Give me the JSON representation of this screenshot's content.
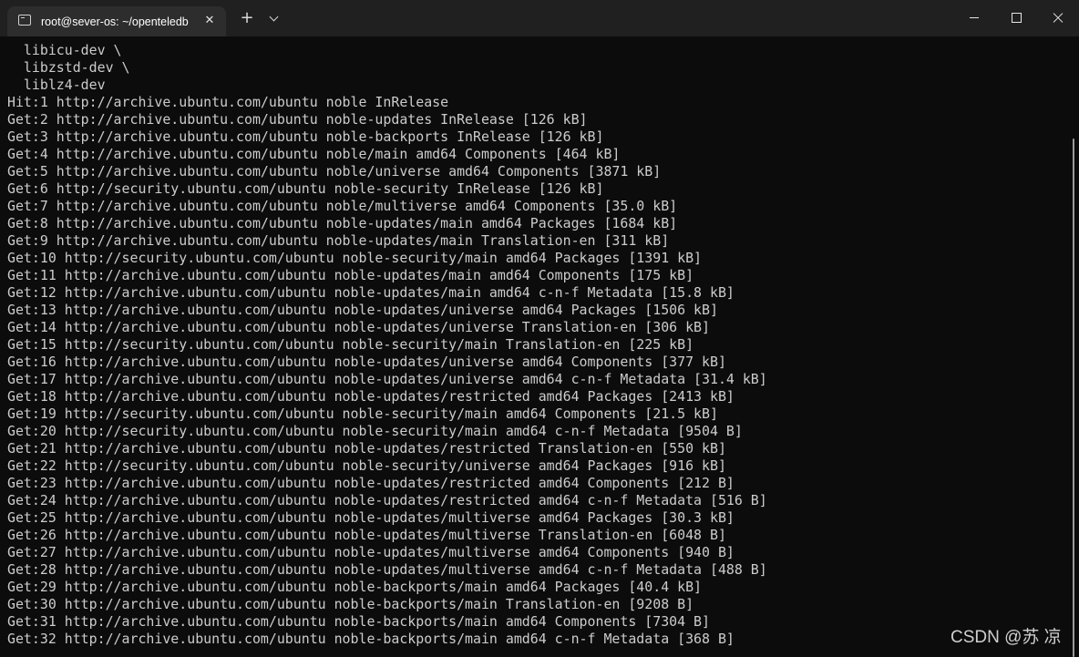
{
  "window": {
    "tab_title": "root@sever-os: ~/openteledb",
    "tab_close_glyph": "✕",
    "new_tab_glyph": "+"
  },
  "terminal": {
    "lines": [
      "  libicu-dev \\",
      "  libzstd-dev \\",
      "  liblz4-dev",
      "Hit:1 http://archive.ubuntu.com/ubuntu noble InRelease",
      "Get:2 http://archive.ubuntu.com/ubuntu noble-updates InRelease [126 kB]",
      "Get:3 http://archive.ubuntu.com/ubuntu noble-backports InRelease [126 kB]",
      "Get:4 http://archive.ubuntu.com/ubuntu noble/main amd64 Components [464 kB]",
      "Get:5 http://archive.ubuntu.com/ubuntu noble/universe amd64 Components [3871 kB]",
      "Get:6 http://security.ubuntu.com/ubuntu noble-security InRelease [126 kB]",
      "Get:7 http://archive.ubuntu.com/ubuntu noble/multiverse amd64 Components [35.0 kB]",
      "Get:8 http://archive.ubuntu.com/ubuntu noble-updates/main amd64 Packages [1684 kB]",
      "Get:9 http://archive.ubuntu.com/ubuntu noble-updates/main Translation-en [311 kB]",
      "Get:10 http://security.ubuntu.com/ubuntu noble-security/main amd64 Packages [1391 kB]",
      "Get:11 http://archive.ubuntu.com/ubuntu noble-updates/main amd64 Components [175 kB]",
      "Get:12 http://archive.ubuntu.com/ubuntu noble-updates/main amd64 c-n-f Metadata [15.8 kB]",
      "Get:13 http://archive.ubuntu.com/ubuntu noble-updates/universe amd64 Packages [1506 kB]",
      "Get:14 http://archive.ubuntu.com/ubuntu noble-updates/universe Translation-en [306 kB]",
      "Get:15 http://security.ubuntu.com/ubuntu noble-security/main Translation-en [225 kB]",
      "Get:16 http://archive.ubuntu.com/ubuntu noble-updates/universe amd64 Components [377 kB]",
      "Get:17 http://archive.ubuntu.com/ubuntu noble-updates/universe amd64 c-n-f Metadata [31.4 kB]",
      "Get:18 http://archive.ubuntu.com/ubuntu noble-updates/restricted amd64 Packages [2413 kB]",
      "Get:19 http://security.ubuntu.com/ubuntu noble-security/main amd64 Components [21.5 kB]",
      "Get:20 http://security.ubuntu.com/ubuntu noble-security/main amd64 c-n-f Metadata [9504 B]",
      "Get:21 http://archive.ubuntu.com/ubuntu noble-updates/restricted Translation-en [550 kB]",
      "Get:22 http://security.ubuntu.com/ubuntu noble-security/universe amd64 Packages [916 kB]",
      "Get:23 http://archive.ubuntu.com/ubuntu noble-updates/restricted amd64 Components [212 B]",
      "Get:24 http://archive.ubuntu.com/ubuntu noble-updates/restricted amd64 c-n-f Metadata [516 B]",
      "Get:25 http://archive.ubuntu.com/ubuntu noble-updates/multiverse amd64 Packages [30.3 kB]",
      "Get:26 http://archive.ubuntu.com/ubuntu noble-updates/multiverse Translation-en [6048 B]",
      "Get:27 http://archive.ubuntu.com/ubuntu noble-updates/multiverse amd64 Components [940 B]",
      "Get:28 http://archive.ubuntu.com/ubuntu noble-updates/multiverse amd64 c-n-f Metadata [488 B]",
      "Get:29 http://archive.ubuntu.com/ubuntu noble-backports/main amd64 Packages [40.4 kB]",
      "Get:30 http://archive.ubuntu.com/ubuntu noble-backports/main Translation-en [9208 B]",
      "Get:31 http://archive.ubuntu.com/ubuntu noble-backports/main amd64 Components [7304 B]",
      "Get:32 http://archive.ubuntu.com/ubuntu noble-backports/main amd64 c-n-f Metadata [368 B]"
    ]
  },
  "watermark": "CSDN @苏 凉",
  "colors": {
    "titlebar_bg": "#202020",
    "tab_bg": "#2d2d2d",
    "terminal_bg": "#0c0c0c",
    "terminal_fg": "#cccccc"
  }
}
